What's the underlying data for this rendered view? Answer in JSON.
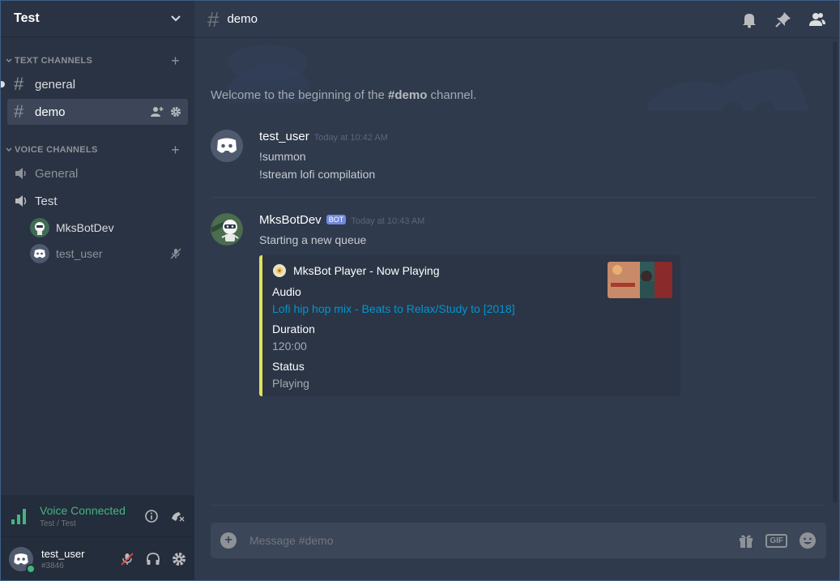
{
  "server": {
    "name": "Test"
  },
  "categories": {
    "text": "TEXT CHANNELS",
    "voice": "VOICE CHANNELS"
  },
  "text_channels": [
    {
      "name": "general",
      "active": false
    },
    {
      "name": "demo",
      "active": true
    }
  ],
  "voice_channels": [
    {
      "name": "General"
    },
    {
      "name": "Test",
      "users": [
        {
          "name": "MksBotDev"
        },
        {
          "name": "test_user"
        }
      ]
    }
  ],
  "voice_panel": {
    "status": "Voice Connected",
    "location": "Test / Test"
  },
  "user_panel": {
    "name": "test_user",
    "tag": "#3846"
  },
  "topbar": {
    "channel": "demo"
  },
  "welcome": {
    "prefix": "Welcome to the beginning of the ",
    "channel": "#demo",
    "suffix": " channel."
  },
  "messages": [
    {
      "author": "test_user",
      "timestamp": "Today at 10:42 AM",
      "lines": [
        "!summon",
        "!stream lofi compilation"
      ]
    },
    {
      "author": "MksBotDev",
      "bot_tag": "BOT",
      "timestamp": "Today at 10:43 AM",
      "lines": [
        "Starting a new queue"
      ],
      "embed": {
        "author": "MksBot Player - Now Playing",
        "accent": "#e0e25a",
        "fields": [
          {
            "name": "Audio",
            "value": "Lofi hip hop mix - Beats to Relax/Study to [2018]",
            "is_link": true
          },
          {
            "name": "Duration",
            "value": "120:00"
          },
          {
            "name": "Status",
            "value": "Playing"
          }
        ]
      }
    }
  ],
  "composer": {
    "placeholder": "Message #demo",
    "gif_label": "GIF"
  },
  "colors": {
    "online": "#43b581",
    "bot_tag": "#7289da",
    "link": "#0096cf",
    "blurple": "#7289da"
  }
}
